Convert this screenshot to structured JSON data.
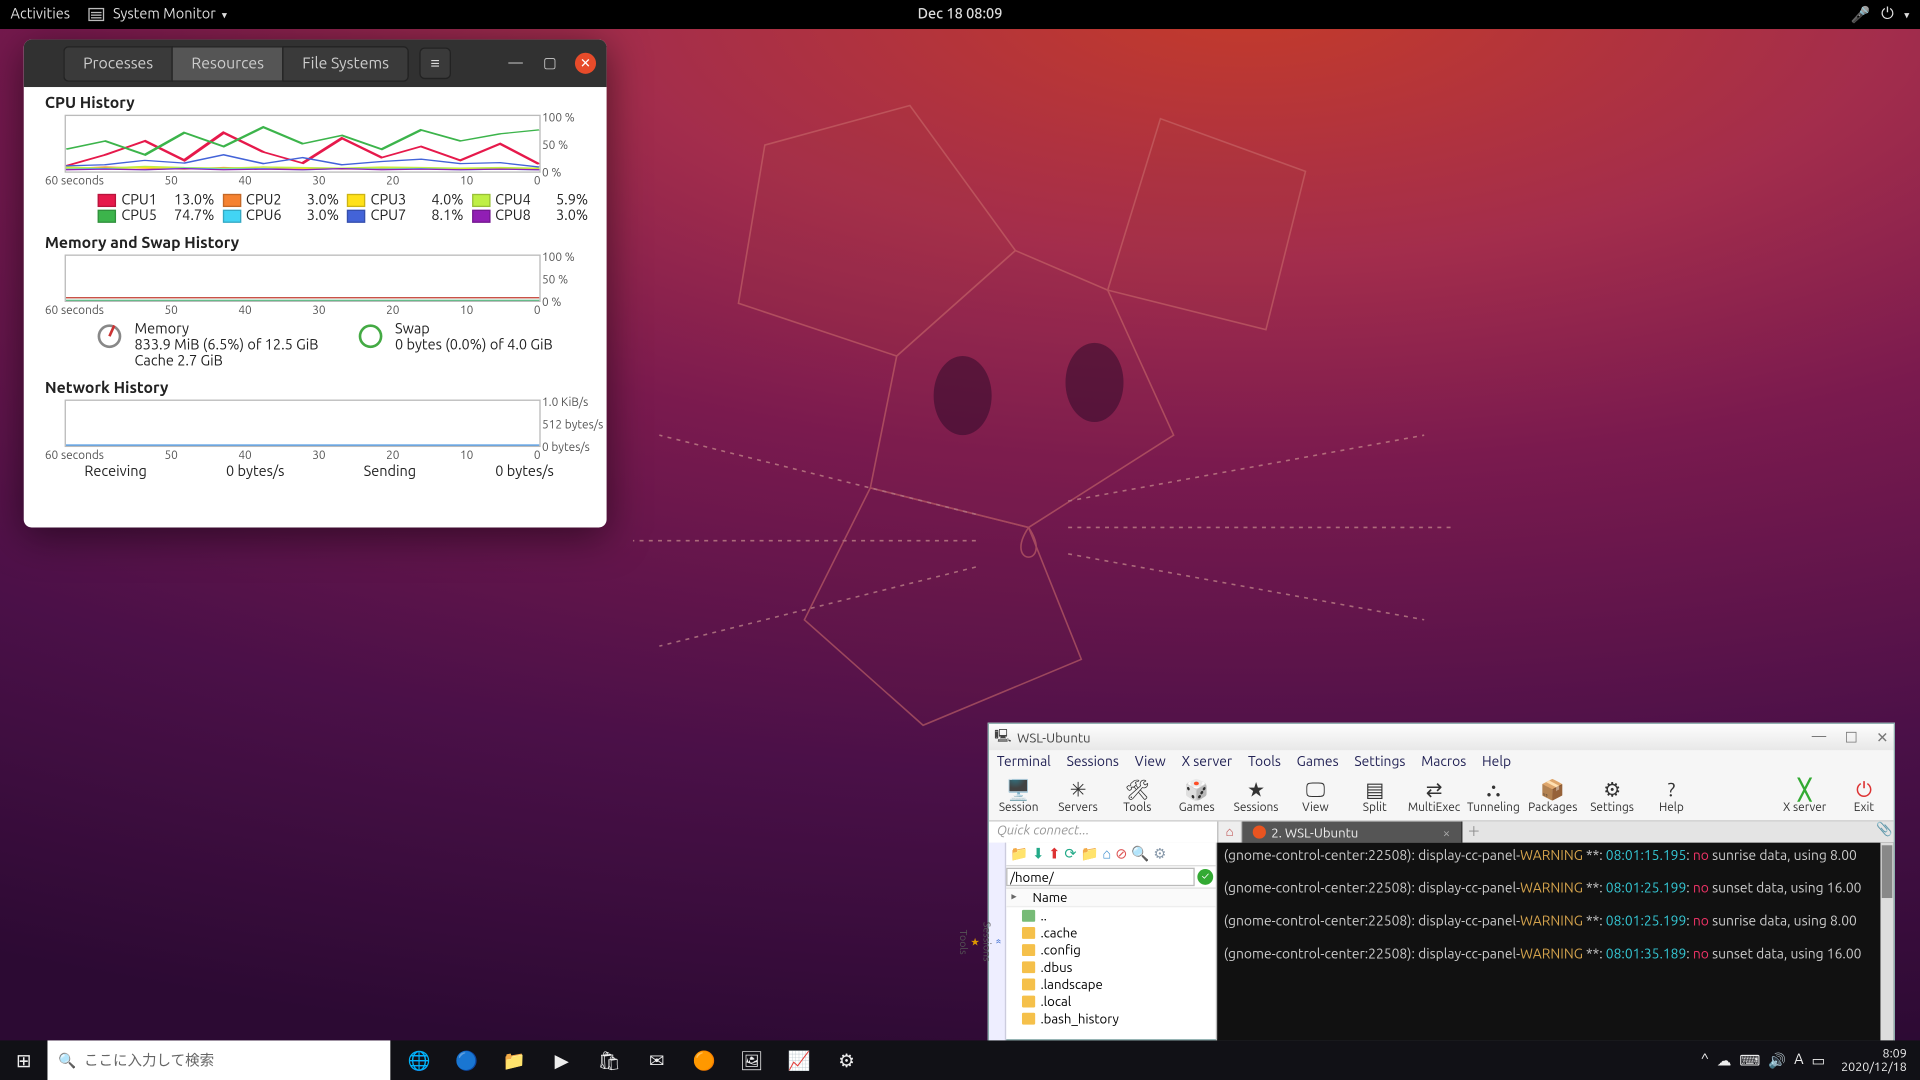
{
  "gnome_bar": {
    "activities": "Activities",
    "app": "System Monitor",
    "clock": "Dec 18  08:09",
    "icons": [
      "mic-icon",
      "power-icon",
      "caret-icon"
    ]
  },
  "sysmon": {
    "tabs": [
      "Processes",
      "Resources",
      "File Systems"
    ],
    "active_tab": 1,
    "cpu": {
      "title": "CPU History",
      "ylabels": [
        "100 %",
        "50 %",
        "0 %"
      ],
      "xlabels": [
        "60 seconds",
        "50",
        "40",
        "30",
        "20",
        "10",
        "0"
      ],
      "legend": [
        {
          "name": "CPU1",
          "pct": "13.0%",
          "color": "#e6194b"
        },
        {
          "name": "CPU2",
          "pct": "3.0%",
          "color": "#f58231"
        },
        {
          "name": "CPU3",
          "pct": "4.0%",
          "color": "#ffe119"
        },
        {
          "name": "CPU4",
          "pct": "5.9%",
          "color": "#bfef45"
        },
        {
          "name": "CPU5",
          "pct": "74.7%",
          "color": "#3cb44b"
        },
        {
          "name": "CPU6",
          "pct": "3.0%",
          "color": "#42d4f4"
        },
        {
          "name": "CPU7",
          "pct": "8.1%",
          "color": "#4363d8"
        },
        {
          "name": "CPU8",
          "pct": "3.0%",
          "color": "#911eb4"
        }
      ]
    },
    "mem": {
      "title": "Memory and Swap History",
      "ylabels": [
        "100 %",
        "50 %",
        "0 %"
      ],
      "memory_label": "Memory",
      "memory_line": "833.9 MiB (6.5%) of 12.5 GiB",
      "memory_cache": "Cache 2.7 GiB",
      "swap_label": "Swap",
      "swap_line": "0 bytes (0.0%) of 4.0 GiB"
    },
    "net": {
      "title": "Network History",
      "ylabels": [
        "1.0 KiB/s",
        "512 bytes/s",
        "0 bytes/s"
      ],
      "recv_label": "Receiving",
      "recv_val": "0 bytes/s",
      "send_label": "Sending",
      "send_val": "0 bytes/s"
    }
  },
  "moba": {
    "title": "WSL-Ubuntu",
    "menu": [
      "Terminal",
      "Sessions",
      "View",
      "X server",
      "Tools",
      "Games",
      "Settings",
      "Macros",
      "Help"
    ],
    "toolbar": [
      {
        "label": "Session",
        "icon": "🖥️"
      },
      {
        "label": "Servers",
        "icon": "✳"
      },
      {
        "label": "Tools",
        "icon": "🛠"
      },
      {
        "label": "Games",
        "icon": "🎲"
      },
      {
        "label": "Sessions",
        "icon": "★"
      },
      {
        "label": "View",
        "icon": "🖵"
      },
      {
        "label": "Split",
        "icon": "▤"
      },
      {
        "label": "MultiExec",
        "icon": "⇄"
      },
      {
        "label": "Tunneling",
        "icon": "⛬"
      },
      {
        "label": "Packages",
        "icon": "📦"
      },
      {
        "label": "Settings",
        "icon": "⚙"
      },
      {
        "label": "Help",
        "icon": "?"
      }
    ],
    "toolbar_right": [
      {
        "label": "X server",
        "icon": "╳"
      },
      {
        "label": "Exit",
        "icon": "⏻"
      }
    ],
    "quick_connect": "Quick connect...",
    "tab_label": "2. WSL-Ubuntu",
    "path": "/home/",
    "tree": [
      "..",
      ".cache",
      ".config",
      ".dbus",
      ".landscape",
      ".local",
      ".bash_history"
    ],
    "tree_header": "Name",
    "term_lines": [
      {
        "pre": "(gnome-control-center:22508): display-cc-panel-",
        "w": "WARNING",
        "mid": " **: ",
        "t": "08:01:15.195",
        "post": ": ",
        "no": "no",
        "tail": " sunrise data, using 8.00"
      },
      {
        "pre": "(gnome-control-center:22508): display-cc-panel-",
        "w": "WARNING",
        "mid": " **: ",
        "t": "08:01:25.199",
        "post": ": ",
        "no": "no",
        "tail": " sunset data, using 16.00"
      },
      {
        "pre": "(gnome-control-center:22508): display-cc-panel-",
        "w": "WARNING",
        "mid": " **: ",
        "t": "08:01:25.199",
        "post": ": ",
        "no": "no",
        "tail": " sunrise data, using 8.00"
      },
      {
        "pre": "(gnome-control-center:22508): display-cc-panel-",
        "w": "WARNING",
        "mid": " **: ",
        "t": "08:01:35.189",
        "post": ": ",
        "no": "no",
        "tail": " sunset data, using 16.00"
      }
    ]
  },
  "taskbar": {
    "search_placeholder": "ここに入力して検索",
    "icons_glyph": [
      "🌐",
      "🔵",
      "📁",
      "▶",
      "🛍",
      "✉",
      "🟠",
      "🖼",
      "📈",
      "⚙"
    ],
    "tray": [
      "^",
      "☁",
      "⌨",
      "🔊",
      "A",
      "▭"
    ],
    "time": "8:09",
    "date": "2020/12/18"
  },
  "chart_data": [
    {
      "type": "line",
      "title": "CPU History",
      "xlabel": "seconds ago",
      "ylabel": "%",
      "xlim": [
        60,
        0
      ],
      "ylim": [
        0,
        100
      ],
      "x": [
        60,
        55,
        50,
        45,
        40,
        35,
        30,
        25,
        20,
        15,
        10,
        5,
        0
      ],
      "series": [
        {
          "name": "CPU1",
          "color": "#e6194b",
          "values": [
            10,
            30,
            55,
            20,
            70,
            35,
            15,
            60,
            25,
            45,
            20,
            50,
            13
          ]
        },
        {
          "name": "CPU2",
          "color": "#f58231",
          "values": [
            5,
            8,
            6,
            4,
            7,
            5,
            6,
            4,
            5,
            6,
            4,
            5,
            3
          ]
        },
        {
          "name": "CPU3",
          "color": "#ffe119",
          "values": [
            6,
            5,
            7,
            6,
            5,
            8,
            6,
            5,
            7,
            6,
            5,
            6,
            4
          ]
        },
        {
          "name": "CPU4",
          "color": "#bfef45",
          "values": [
            8,
            6,
            9,
            7,
            6,
            8,
            7,
            6,
            8,
            7,
            6,
            7,
            6
          ]
        },
        {
          "name": "CPU5",
          "color": "#3cb44b",
          "values": [
            40,
            55,
            30,
            70,
            45,
            80,
            50,
            65,
            40,
            75,
            55,
            68,
            75
          ]
        },
        {
          "name": "CPU6",
          "color": "#42d4f4",
          "values": [
            4,
            5,
            3,
            6,
            4,
            5,
            3,
            5,
            4,
            5,
            3,
            4,
            3
          ]
        },
        {
          "name": "CPU7",
          "color": "#4363d8",
          "values": [
            10,
            12,
            20,
            15,
            30,
            14,
            25,
            12,
            18,
            22,
            14,
            16,
            8
          ]
        },
        {
          "name": "CPU8",
          "color": "#911eb4",
          "values": [
            3,
            4,
            3,
            5,
            3,
            4,
            3,
            5,
            3,
            4,
            3,
            4,
            3
          ]
        }
      ]
    },
    {
      "type": "line",
      "title": "Memory and Swap History",
      "xlabel": "seconds ago",
      "ylabel": "%",
      "xlim": [
        60,
        0
      ],
      "ylim": [
        0,
        100
      ],
      "x": [
        60,
        0
      ],
      "series": [
        {
          "name": "Memory",
          "color": "#c0392b",
          "values": [
            6.5,
            6.5
          ]
        },
        {
          "name": "Swap",
          "color": "#27ae60",
          "values": [
            0,
            0
          ]
        }
      ]
    },
    {
      "type": "line",
      "title": "Network History",
      "xlabel": "seconds ago",
      "ylabel": "bytes/s",
      "xlim": [
        60,
        0
      ],
      "ylim": [
        0,
        1024
      ],
      "x": [
        60,
        0
      ],
      "series": [
        {
          "name": "Receiving",
          "color": "#2e86de",
          "values": [
            0,
            0
          ]
        },
        {
          "name": "Sending",
          "color": "#d35400",
          "values": [
            0,
            0
          ]
        }
      ]
    }
  ]
}
